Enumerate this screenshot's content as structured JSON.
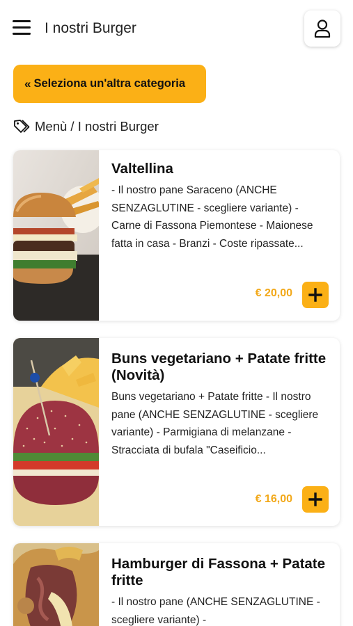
{
  "header": {
    "title": "I nostri Burger"
  },
  "category_button": {
    "chevron": "«",
    "label": "Seleziona un'altra categoria"
  },
  "breadcrumb": {
    "text": "Menù / I nostri Burger"
  },
  "products": [
    {
      "name": "Valtellina",
      "description": "- Il nostro pane Saraceno (ANCHE SENZAGLUTINE - scegliere variante) - Carne di Fassona Piemontese - Maionese fatta in casa - Branzi - Coste ripassate...",
      "price": "€ 20,00"
    },
    {
      "name": "Buns vegetariano + Patate fritte (Novità)",
      "description": "Buns vegetariano + Patate fritte - Il nostro pane (ANCHE SENZAGLUTINE - scegliere variante) - Parmigiana di melanzane - Stracciata di bufala \"Caseificio...",
      "price": "€ 16,00"
    },
    {
      "name": "Hamburger di Fassona + Patate fritte",
      "description": "- Il nostro pane (ANCHE SENZAGLUTINE - scegliere variante) -",
      "price": ""
    }
  ],
  "colors": {
    "accent": "#fbb016",
    "price": "#f2a818"
  },
  "icons": {
    "menu": "hamburger-menu-icon",
    "user": "user-icon",
    "tag": "tag-icon",
    "add": "plus-icon"
  }
}
